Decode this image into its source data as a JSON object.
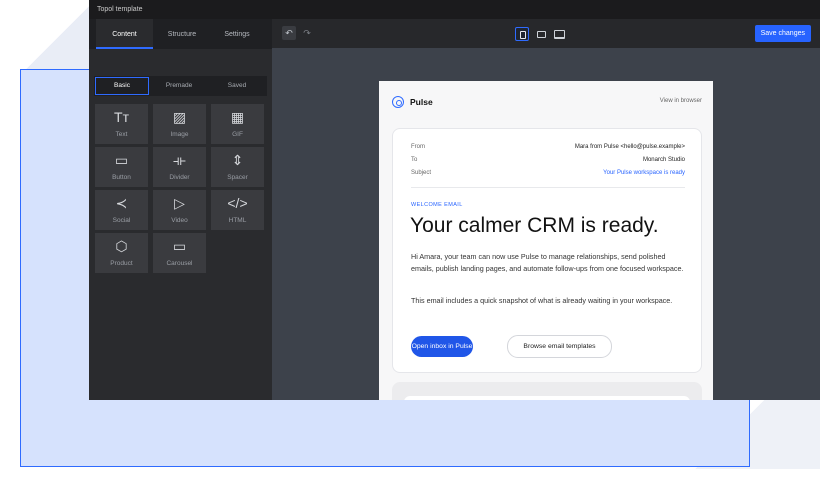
{
  "app_title": "Topol template",
  "toolbar": {
    "undo_icon": "undo-icon",
    "redo_icon": "redo-icon",
    "device_icons": [
      "mobile-icon",
      "tablet-icon",
      "desktop-icon"
    ],
    "save_label": "Save changes",
    "accent": "#2763ff"
  },
  "sidebar": {
    "tabs": [
      "Content",
      "Structure",
      "Settings"
    ],
    "subtabs": [
      "Basic",
      "Premade",
      "Saved"
    ],
    "blocks": [
      {
        "label": "Text",
        "icon": "text-icon",
        "glyph": "Tт"
      },
      {
        "label": "Image",
        "icon": "image-icon",
        "glyph": "▨"
      },
      {
        "label": "GIF",
        "icon": "film-icon",
        "glyph": "▦"
      },
      {
        "label": "Button",
        "icon": "button-icon",
        "glyph": "▭"
      },
      {
        "label": "Divider",
        "icon": "divider-icon",
        "glyph": "⟛"
      },
      {
        "label": "Spacer",
        "icon": "spacer-icon",
        "glyph": "⇕"
      },
      {
        "label": "Social",
        "icon": "share-icon",
        "glyph": "≺"
      },
      {
        "label": "Video",
        "icon": "play-icon",
        "glyph": "▷"
      },
      {
        "label": "HTML",
        "icon": "code-icon",
        "glyph": "</>"
      },
      {
        "label": "Product",
        "icon": "box-icon",
        "glyph": "⬡"
      },
      {
        "label": "Carousel",
        "icon": "carousel-icon",
        "glyph": "▭"
      }
    ]
  },
  "email": {
    "brand": "Pulse",
    "view_in_browser": "View in browser",
    "meta": {
      "from_label": "From",
      "from_value": "Mara from Pulse <hello@pulse.example>",
      "to_label": "To",
      "to_value": "Monarch Studio",
      "subject_label": "Subject",
      "subject_value": "Your Pulse workspace is ready"
    },
    "eyebrow": "WELCOME EMAIL",
    "headline": "Your calmer CRM is ready.",
    "paragraph1": "Hi Amara, your team can now use Pulse to manage relationships, send polished emails, publish landing pages, and automate follow-ups from one focused workspace.",
    "paragraph2": "This email includes a quick snapshot of what is already waiting in your workspace.",
    "primary_button": "Open inbox in Pulse",
    "secondary_button": "Browse email templates"
  }
}
